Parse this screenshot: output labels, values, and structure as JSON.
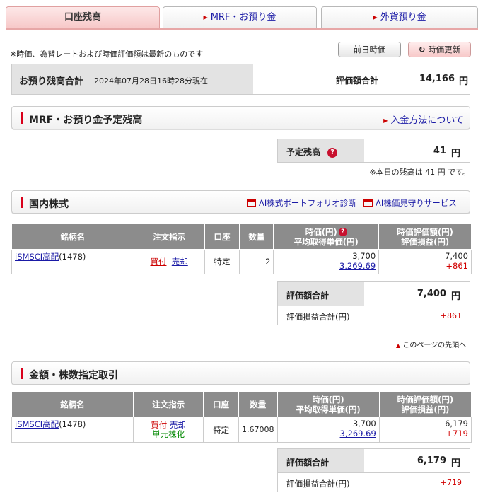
{
  "tabs": [
    {
      "label": "口座残高"
    },
    {
      "label": "MRF・お預り金"
    },
    {
      "label": "外貨預り金"
    }
  ],
  "notice": "※時価、為替レートおよび時価評価額は最新のものです",
  "buttons": {
    "prev_day": "前日時価",
    "refresh": "時価更新"
  },
  "summary": {
    "title": "お預り残高合計",
    "asof": "2024年07月28日16時28分現在",
    "valuation_label": "評価額合計",
    "valuation_value": "14,166",
    "unit": "円"
  },
  "mrf": {
    "title": "MRF・お預り金予定残高",
    "link": "入金方法について",
    "balance_label": "予定残高",
    "balance_value": "41",
    "unit": "円",
    "note": "※本日の残高は 41 円 です。"
  },
  "domestic": {
    "title": "国内株式",
    "link_portfolio": "AI株式ポートフォリオ診断",
    "link_watch": "AI株価見守りサービス",
    "headers": {
      "name": "銘柄名",
      "order": "注文指示",
      "account": "口座",
      "qty": "数量",
      "price1": "時価(円)",
      "price2": "平均取得単価(円)",
      "val1": "時価評価額(円)",
      "val2": "評価損益(円)"
    },
    "row": {
      "name": "iSMSCI高配",
      "code": "(1478)",
      "buy": "買付",
      "sell": "売却",
      "account": "特定",
      "qty": "2",
      "price": "3,700",
      "avg": "3,269.69",
      "valuation": "7,400",
      "pl": "+861"
    },
    "total_label": "評価額合計",
    "total_value": "7,400",
    "unit": "円",
    "pl_label": "評価損益合計(円)",
    "pl_value": "+861",
    "top_link": "このページの先頭へ"
  },
  "amount": {
    "title": "金額・株数指定取引",
    "headers": {
      "name": "銘柄名",
      "order": "注文指示",
      "account": "口座",
      "qty": "数量",
      "price1": "時価(円)",
      "price2": "平均取得単価(円)",
      "val1": "時価評価額(円)",
      "val2": "評価損益(円)"
    },
    "row": {
      "name": "iSMSCI高配",
      "code": "(1478)",
      "buy": "買付",
      "sell": "売却",
      "unit_conv": "単元株化",
      "account": "特定",
      "qty": "1.67008",
      "price": "3,700",
      "avg": "3,269.69",
      "valuation": "6,179",
      "pl": "+719"
    },
    "total_label": "評価額合計",
    "total_value": "6,179",
    "unit": "円",
    "pl_label": "評価損益合計(円)",
    "pl_value": "+719"
  },
  "colors": {
    "accent_red": "#d9001b",
    "link_blue": "#1a1aa6",
    "header_gray": "#8c8c8c",
    "label_gray": "#e3e3e3"
  }
}
